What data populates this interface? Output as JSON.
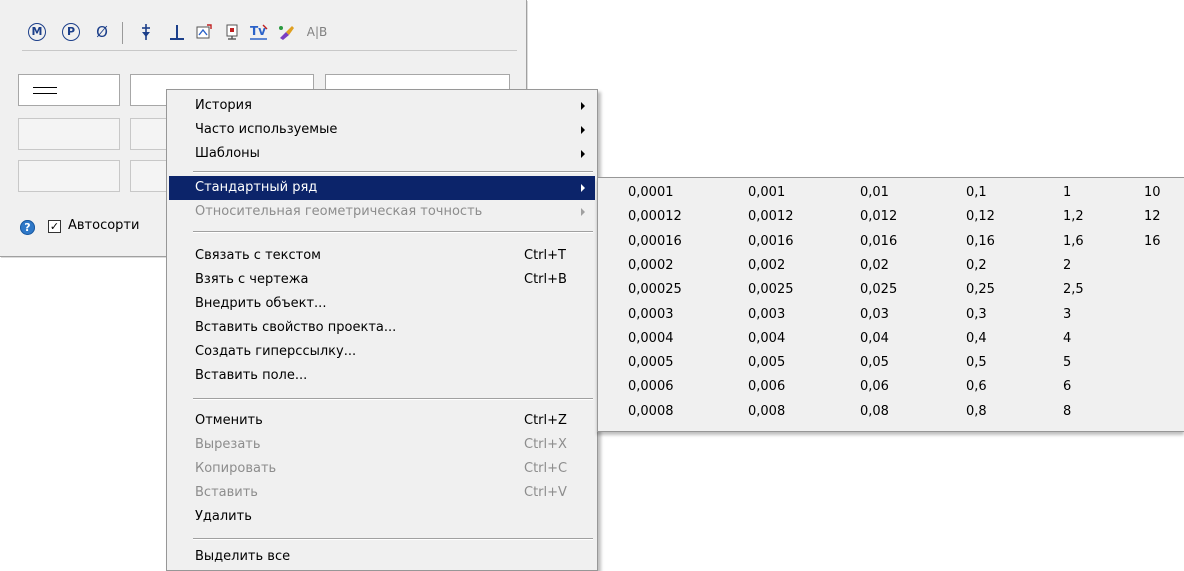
{
  "toolbar": {
    "buttons": [
      {
        "name": "m-circle-icon",
        "glyph": "M",
        "circle": true
      },
      {
        "name": "p-circle-icon",
        "glyph": "P",
        "circle": true
      },
      {
        "name": "diameter-icon",
        "glyph": "Ø",
        "circle": false
      },
      {
        "name": "plus-minus-arrow-icon",
        "glyph": "⍖",
        "circle": false
      },
      {
        "name": "perpendicular-icon",
        "glyph": "⊥",
        "circle": false
      },
      {
        "name": "insert-symbol-icon",
        "glyph": "⎘",
        "circle": false
      },
      {
        "name": "insert-fragment-icon",
        "glyph": "⎙",
        "circle": false
      },
      {
        "name": "text-template-icon",
        "glyph": "Ⓣ",
        "circle": false
      },
      {
        "name": "format-brush-icon",
        "glyph": "✎",
        "circle": false
      },
      {
        "name": "ab-split-icon",
        "glyph": "A|B",
        "circle": false
      }
    ]
  },
  "checkbox": {
    "checked_mark": "✓",
    "label": "Автосорти"
  },
  "help_icon": "?",
  "menu": {
    "history": "История",
    "frequent": "Часто используемые",
    "templates": "Шаблоны",
    "standard_row": "Стандартный ряд",
    "relative_precision": "Относительная геометрическая точность",
    "link_text": "Связать с текстом",
    "link_text_sc": "Ctrl+T",
    "take_drawing": "Взять с чертежа",
    "take_drawing_sc": "Ctrl+B",
    "embed_object": "Внедрить объект...",
    "insert_project_prop": "Вставить свойство проекта...",
    "create_hyperlink": "Создать гиперссылку...",
    "insert_field": "Вставить поле...",
    "undo": "Отменить",
    "undo_sc": "Ctrl+Z",
    "cut": "Вырезать",
    "cut_sc": "Ctrl+X",
    "copy": "Копировать",
    "copy_sc": "Ctrl+C",
    "paste": "Вставить",
    "paste_sc": "Ctrl+V",
    "delete": "Удалить",
    "select_all": "Выделить все"
  },
  "standard_series": {
    "columns": [
      [
        "0,0001",
        "0,00012",
        "0,00016",
        "0,0002",
        "0,00025",
        "0,0003",
        "0,0004",
        "0,0005",
        "0,0006",
        "0,0008"
      ],
      [
        "0,001",
        "0,0012",
        "0,0016",
        "0,002",
        "0,0025",
        "0,003",
        "0,004",
        "0,005",
        "0,006",
        "0,008"
      ],
      [
        "0,01",
        "0,012",
        "0,016",
        "0,02",
        "0,025",
        "0,03",
        "0,04",
        "0,05",
        "0,06",
        "0,08"
      ],
      [
        "0,1",
        "0,12",
        "0,16",
        "0,2",
        "0,25",
        "0,3",
        "0,4",
        "0,5",
        "0,6",
        "0,8"
      ],
      [
        "1",
        "1,2",
        "1,6",
        "2",
        "2,5",
        "3",
        "4",
        "5",
        "6",
        "8"
      ],
      [
        "10",
        "12",
        "16"
      ]
    ]
  },
  "colors": {
    "menu_bg": "#f0f0f0",
    "selection": "#0c246a",
    "disabled_text": "#8d8d8d",
    "icon_blue": "#1c3f8a"
  }
}
